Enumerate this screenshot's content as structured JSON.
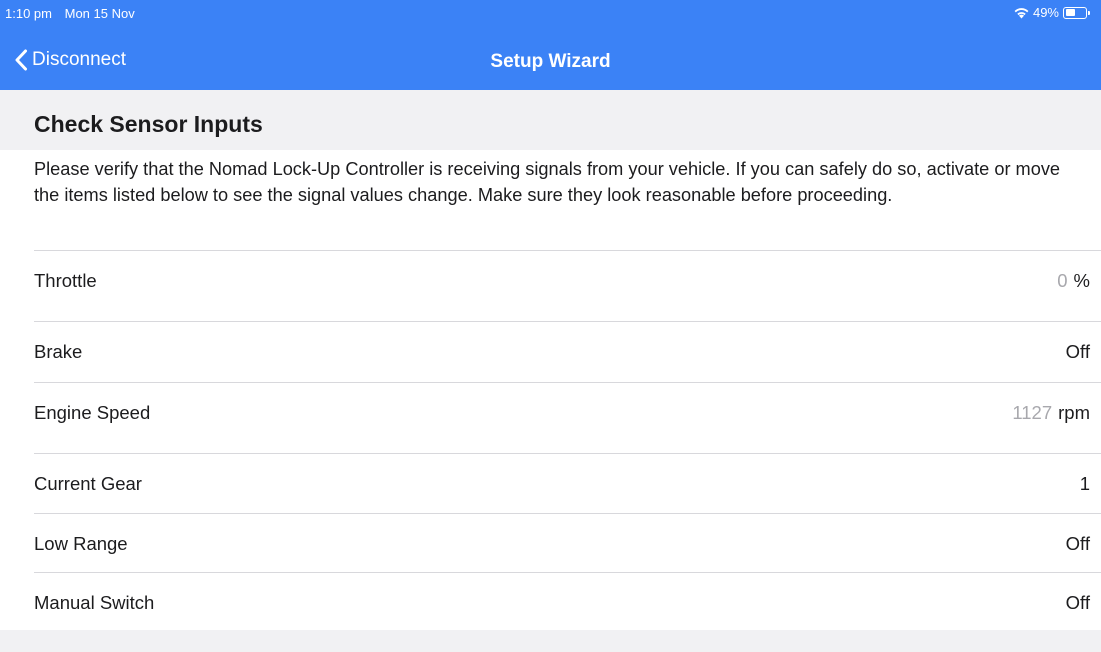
{
  "status_bar": {
    "time": "1:10 pm",
    "date": "Mon 15 Nov",
    "battery_percent": "49%",
    "battery_level": 0.49,
    "wifi_icon": "wifi-icon",
    "battery_icon": "battery-icon"
  },
  "nav": {
    "back_label": "Disconnect",
    "back_icon": "chevron-left-icon",
    "title": "Setup Wizard"
  },
  "section": {
    "title": "Check Sensor Inputs",
    "description": "Please verify that the Nomad Lock-Up Controller is receiving signals from your vehicle. If you can safely do so, activate or move the items listed below to see the signal values change. Make sure they look reasonable before proceeding."
  },
  "rows": [
    {
      "label": "Throttle",
      "number": "0",
      "unit": "%"
    },
    {
      "label": "Brake",
      "number": "",
      "unit": "Off"
    },
    {
      "label": "Engine Speed",
      "number": "1127",
      "unit": "rpm"
    },
    {
      "label": "Current Gear",
      "number": "",
      "unit": "1"
    },
    {
      "label": "Low Range",
      "number": "",
      "unit": "Off"
    },
    {
      "label": "Manual Switch",
      "number": "",
      "unit": "Off"
    }
  ],
  "colors": {
    "accent": "#3b82f6",
    "background": "#f1f1f3",
    "panel": "#ffffff",
    "muted_value": "#a8a8ad"
  }
}
